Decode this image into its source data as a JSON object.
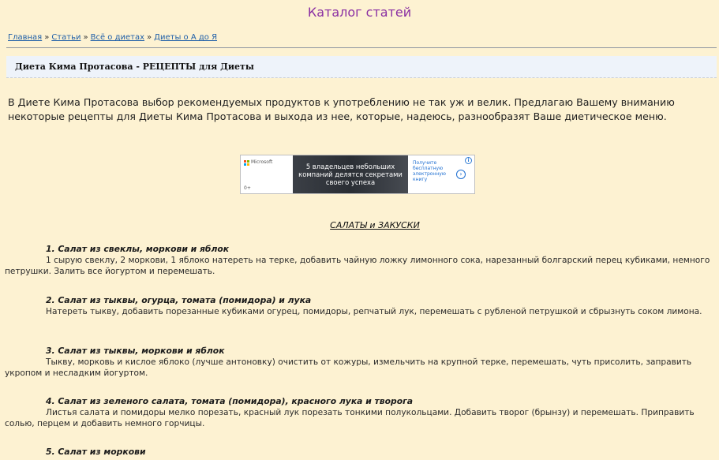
{
  "site": {
    "title": "Каталог статей"
  },
  "breadcrumb": {
    "items": [
      "Главная",
      "Статьи",
      "Всё о диетах",
      "Диеты о А до Я"
    ],
    "separator": "»"
  },
  "article": {
    "title": "Диета Кима Протасова - РЕЦЕПТЫ для Диеты",
    "intro": "В Диете Кима Протасова выбор рекомендуемых продуктов к употреблению не так уж и велик. Предлагаю Вашему вниманию некоторые рецепты для Диеты Кима Протасова и выхода из нее, которые, надеюсь, разнообразят Ваше диетическое меню.",
    "section_title": "САЛАТЫ и ЗАКУСКИ",
    "recipes": [
      {
        "title": "1. Салат из свеклы, моркови и яблок",
        "text": "1 сырую свеклу, 2 моркови, 1 яблоко натереть на терке, добавить чайную ложку лимонного сока, нарезанный болгарский перец кубиками, немного петрушки. Залить все йогуртом и перемешать."
      },
      {
        "title": "2. Салат из тыквы, огурца, томата (помидора) и лука",
        "text": "Натереть тыкву, добавить порезанные кубиками огурец, помидоры, репчатый лук, перемешать с рубленой петрушкой и сбрызнуть соком лимона."
      },
      {
        "title": "3. Салат из тыквы, моркови и яблок",
        "text": "Тыкву, морковь и кислое яблоко (лучше антоновку) очистить от кожуры, измельчить на крупной терке, перемешать, чуть присолить, заправить укропом и несладким йогуртом."
      },
      {
        "title": "4. Салат из зеленого салата, томата (помидора), красного лука и творога",
        "text": "Листья салата и помидоры мелко порезать, красный лук порезать тонкими полукольцами. Добавить творог (брынзу) и перемешать. Приправить солью, перцем и добавить немного горчицы."
      },
      {
        "title": "5. Салат из моркови",
        "text": ""
      }
    ]
  },
  "ad": {
    "brand": "Microsoft",
    "age_rating": "0+",
    "headline": "5 владельцев небольших компаний делятся секретами своего успеха",
    "cta": "Получите бесплатную электронную книгу",
    "info_icon": "info-icon",
    "arrow_icon": "arrow-right-circle-icon"
  },
  "colors": {
    "background": "#fdf2d2",
    "site_title": "#8a2fa3",
    "link": "#1f5fa8",
    "header_band": "#eef3fa"
  }
}
